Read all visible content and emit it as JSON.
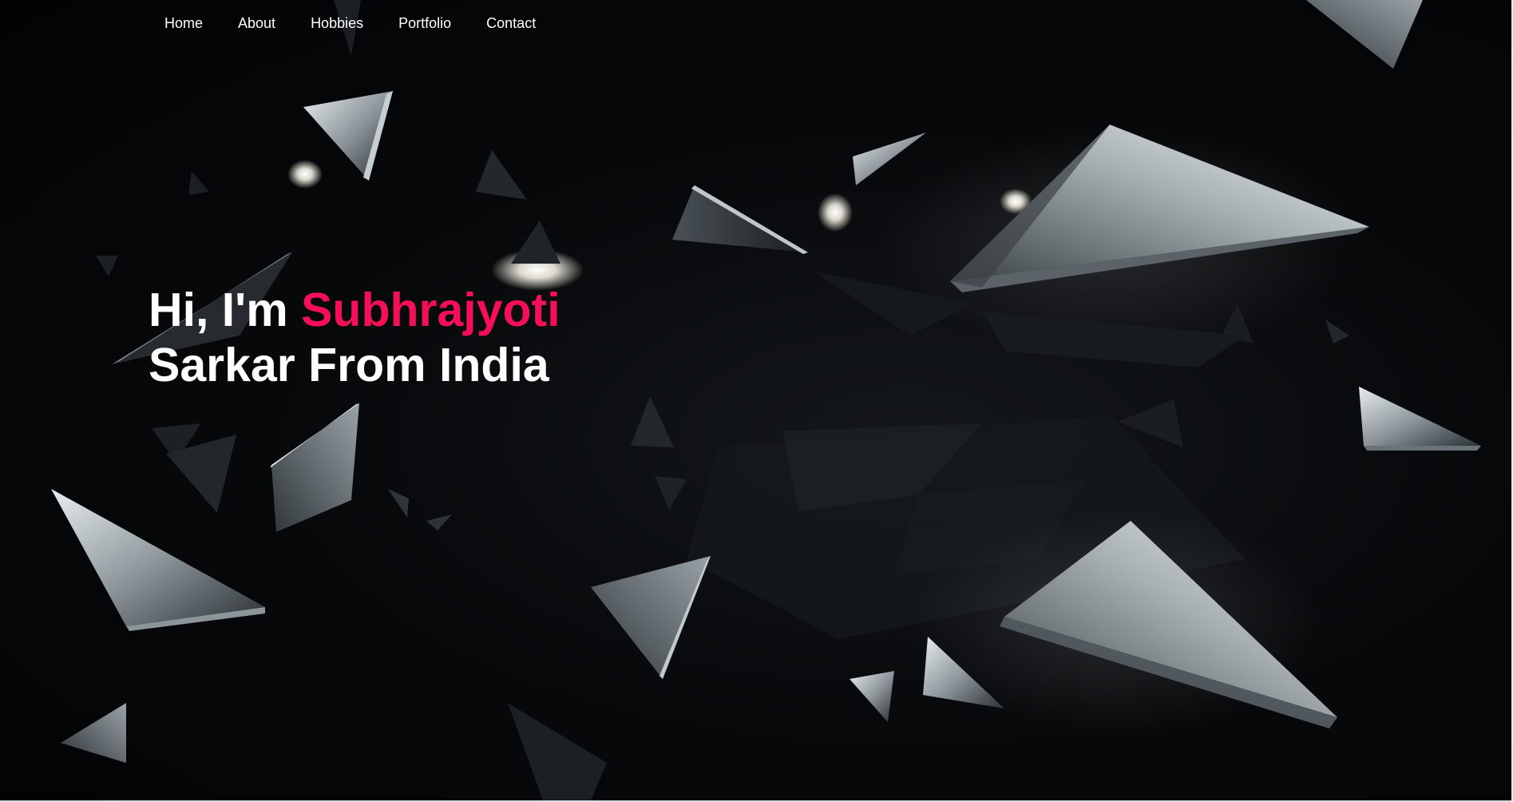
{
  "nav": {
    "items": [
      {
        "label": "Home"
      },
      {
        "label": "About"
      },
      {
        "label": "Hobbies"
      },
      {
        "label": "Portfolio"
      },
      {
        "label": "Contact"
      }
    ]
  },
  "hero": {
    "greeting": "Hi, I'm ",
    "name": "Subhrajyoti",
    "tagline": "Sarkar From India"
  },
  "colors": {
    "accent": "#f50f57",
    "background": "#050607",
    "text": "#ffffff"
  }
}
